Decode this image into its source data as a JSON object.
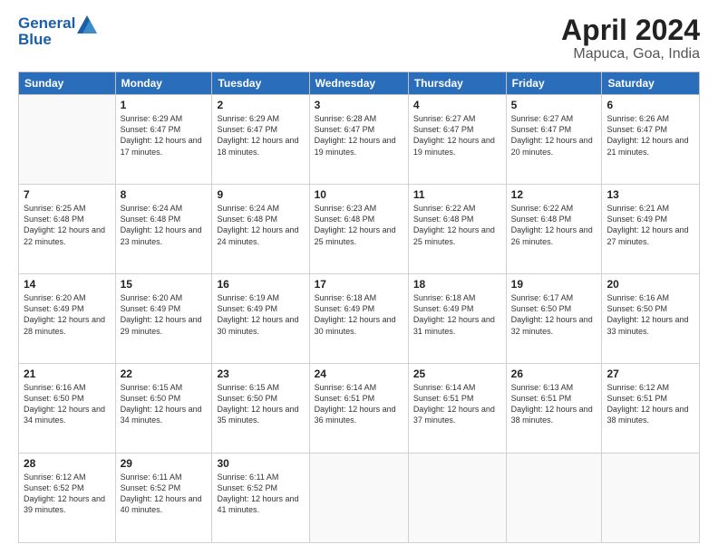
{
  "header": {
    "logo_line1": "General",
    "logo_line2": "Blue",
    "title": "April 2024",
    "subtitle": "Mapuca, Goa, India"
  },
  "weekdays": [
    "Sunday",
    "Monday",
    "Tuesday",
    "Wednesday",
    "Thursday",
    "Friday",
    "Saturday"
  ],
  "weeks": [
    [
      {
        "day": "",
        "sunrise": "",
        "sunset": "",
        "daylight": ""
      },
      {
        "day": "1",
        "sunrise": "Sunrise: 6:29 AM",
        "sunset": "Sunset: 6:47 PM",
        "daylight": "Daylight: 12 hours and 17 minutes."
      },
      {
        "day": "2",
        "sunrise": "Sunrise: 6:29 AM",
        "sunset": "Sunset: 6:47 PM",
        "daylight": "Daylight: 12 hours and 18 minutes."
      },
      {
        "day": "3",
        "sunrise": "Sunrise: 6:28 AM",
        "sunset": "Sunset: 6:47 PM",
        "daylight": "Daylight: 12 hours and 19 minutes."
      },
      {
        "day": "4",
        "sunrise": "Sunrise: 6:27 AM",
        "sunset": "Sunset: 6:47 PM",
        "daylight": "Daylight: 12 hours and 19 minutes."
      },
      {
        "day": "5",
        "sunrise": "Sunrise: 6:27 AM",
        "sunset": "Sunset: 6:47 PM",
        "daylight": "Daylight: 12 hours and 20 minutes."
      },
      {
        "day": "6",
        "sunrise": "Sunrise: 6:26 AM",
        "sunset": "Sunset: 6:47 PM",
        "daylight": "Daylight: 12 hours and 21 minutes."
      }
    ],
    [
      {
        "day": "7",
        "sunrise": "Sunrise: 6:25 AM",
        "sunset": "Sunset: 6:48 PM",
        "daylight": "Daylight: 12 hours and 22 minutes."
      },
      {
        "day": "8",
        "sunrise": "Sunrise: 6:24 AM",
        "sunset": "Sunset: 6:48 PM",
        "daylight": "Daylight: 12 hours and 23 minutes."
      },
      {
        "day": "9",
        "sunrise": "Sunrise: 6:24 AM",
        "sunset": "Sunset: 6:48 PM",
        "daylight": "Daylight: 12 hours and 24 minutes."
      },
      {
        "day": "10",
        "sunrise": "Sunrise: 6:23 AM",
        "sunset": "Sunset: 6:48 PM",
        "daylight": "Daylight: 12 hours and 25 minutes."
      },
      {
        "day": "11",
        "sunrise": "Sunrise: 6:22 AM",
        "sunset": "Sunset: 6:48 PM",
        "daylight": "Daylight: 12 hours and 25 minutes."
      },
      {
        "day": "12",
        "sunrise": "Sunrise: 6:22 AM",
        "sunset": "Sunset: 6:48 PM",
        "daylight": "Daylight: 12 hours and 26 minutes."
      },
      {
        "day": "13",
        "sunrise": "Sunrise: 6:21 AM",
        "sunset": "Sunset: 6:49 PM",
        "daylight": "Daylight: 12 hours and 27 minutes."
      }
    ],
    [
      {
        "day": "14",
        "sunrise": "Sunrise: 6:20 AM",
        "sunset": "Sunset: 6:49 PM",
        "daylight": "Daylight: 12 hours and 28 minutes."
      },
      {
        "day": "15",
        "sunrise": "Sunrise: 6:20 AM",
        "sunset": "Sunset: 6:49 PM",
        "daylight": "Daylight: 12 hours and 29 minutes."
      },
      {
        "day": "16",
        "sunrise": "Sunrise: 6:19 AM",
        "sunset": "Sunset: 6:49 PM",
        "daylight": "Daylight: 12 hours and 30 minutes."
      },
      {
        "day": "17",
        "sunrise": "Sunrise: 6:18 AM",
        "sunset": "Sunset: 6:49 PM",
        "daylight": "Daylight: 12 hours and 30 minutes."
      },
      {
        "day": "18",
        "sunrise": "Sunrise: 6:18 AM",
        "sunset": "Sunset: 6:49 PM",
        "daylight": "Daylight: 12 hours and 31 minutes."
      },
      {
        "day": "19",
        "sunrise": "Sunrise: 6:17 AM",
        "sunset": "Sunset: 6:50 PM",
        "daylight": "Daylight: 12 hours and 32 minutes."
      },
      {
        "day": "20",
        "sunrise": "Sunrise: 6:16 AM",
        "sunset": "Sunset: 6:50 PM",
        "daylight": "Daylight: 12 hours and 33 minutes."
      }
    ],
    [
      {
        "day": "21",
        "sunrise": "Sunrise: 6:16 AM",
        "sunset": "Sunset: 6:50 PM",
        "daylight": "Daylight: 12 hours and 34 minutes."
      },
      {
        "day": "22",
        "sunrise": "Sunrise: 6:15 AM",
        "sunset": "Sunset: 6:50 PM",
        "daylight": "Daylight: 12 hours and 34 minutes."
      },
      {
        "day": "23",
        "sunrise": "Sunrise: 6:15 AM",
        "sunset": "Sunset: 6:50 PM",
        "daylight": "Daylight: 12 hours and 35 minutes."
      },
      {
        "day": "24",
        "sunrise": "Sunrise: 6:14 AM",
        "sunset": "Sunset: 6:51 PM",
        "daylight": "Daylight: 12 hours and 36 minutes."
      },
      {
        "day": "25",
        "sunrise": "Sunrise: 6:14 AM",
        "sunset": "Sunset: 6:51 PM",
        "daylight": "Daylight: 12 hours and 37 minutes."
      },
      {
        "day": "26",
        "sunrise": "Sunrise: 6:13 AM",
        "sunset": "Sunset: 6:51 PM",
        "daylight": "Daylight: 12 hours and 38 minutes."
      },
      {
        "day": "27",
        "sunrise": "Sunrise: 6:12 AM",
        "sunset": "Sunset: 6:51 PM",
        "daylight": "Daylight: 12 hours and 38 minutes."
      }
    ],
    [
      {
        "day": "28",
        "sunrise": "Sunrise: 6:12 AM",
        "sunset": "Sunset: 6:52 PM",
        "daylight": "Daylight: 12 hours and 39 minutes."
      },
      {
        "day": "29",
        "sunrise": "Sunrise: 6:11 AM",
        "sunset": "Sunset: 6:52 PM",
        "daylight": "Daylight: 12 hours and 40 minutes."
      },
      {
        "day": "30",
        "sunrise": "Sunrise: 6:11 AM",
        "sunset": "Sunset: 6:52 PM",
        "daylight": "Daylight: 12 hours and 41 minutes."
      },
      {
        "day": "",
        "sunrise": "",
        "sunset": "",
        "daylight": ""
      },
      {
        "day": "",
        "sunrise": "",
        "sunset": "",
        "daylight": ""
      },
      {
        "day": "",
        "sunrise": "",
        "sunset": "",
        "daylight": ""
      },
      {
        "day": "",
        "sunrise": "",
        "sunset": "",
        "daylight": ""
      }
    ]
  ]
}
